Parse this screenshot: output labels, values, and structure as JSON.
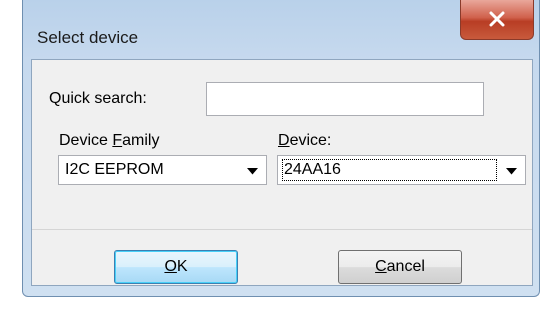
{
  "window": {
    "title": "Select device"
  },
  "search": {
    "label": "Quick search:",
    "value": ""
  },
  "family": {
    "label_pre": "Device ",
    "label_accel": "F",
    "label_post": "amily",
    "selected": "I2C EEPROM"
  },
  "device": {
    "label_accel": "D",
    "label_post": "evice:",
    "selected": "24AA16"
  },
  "buttons": {
    "ok": {
      "accel": "O",
      "rest": "K"
    },
    "cancel": {
      "accel": "C",
      "rest": "ancel"
    }
  },
  "icons": {
    "close": "close-icon",
    "dropdown": "chevron-down-icon"
  },
  "colors": {
    "close_button": "#c85a3c",
    "window_frame": "#b9d1ea",
    "client_bg": "#f0f0f0",
    "default_button_border": "#3c7fb1"
  }
}
